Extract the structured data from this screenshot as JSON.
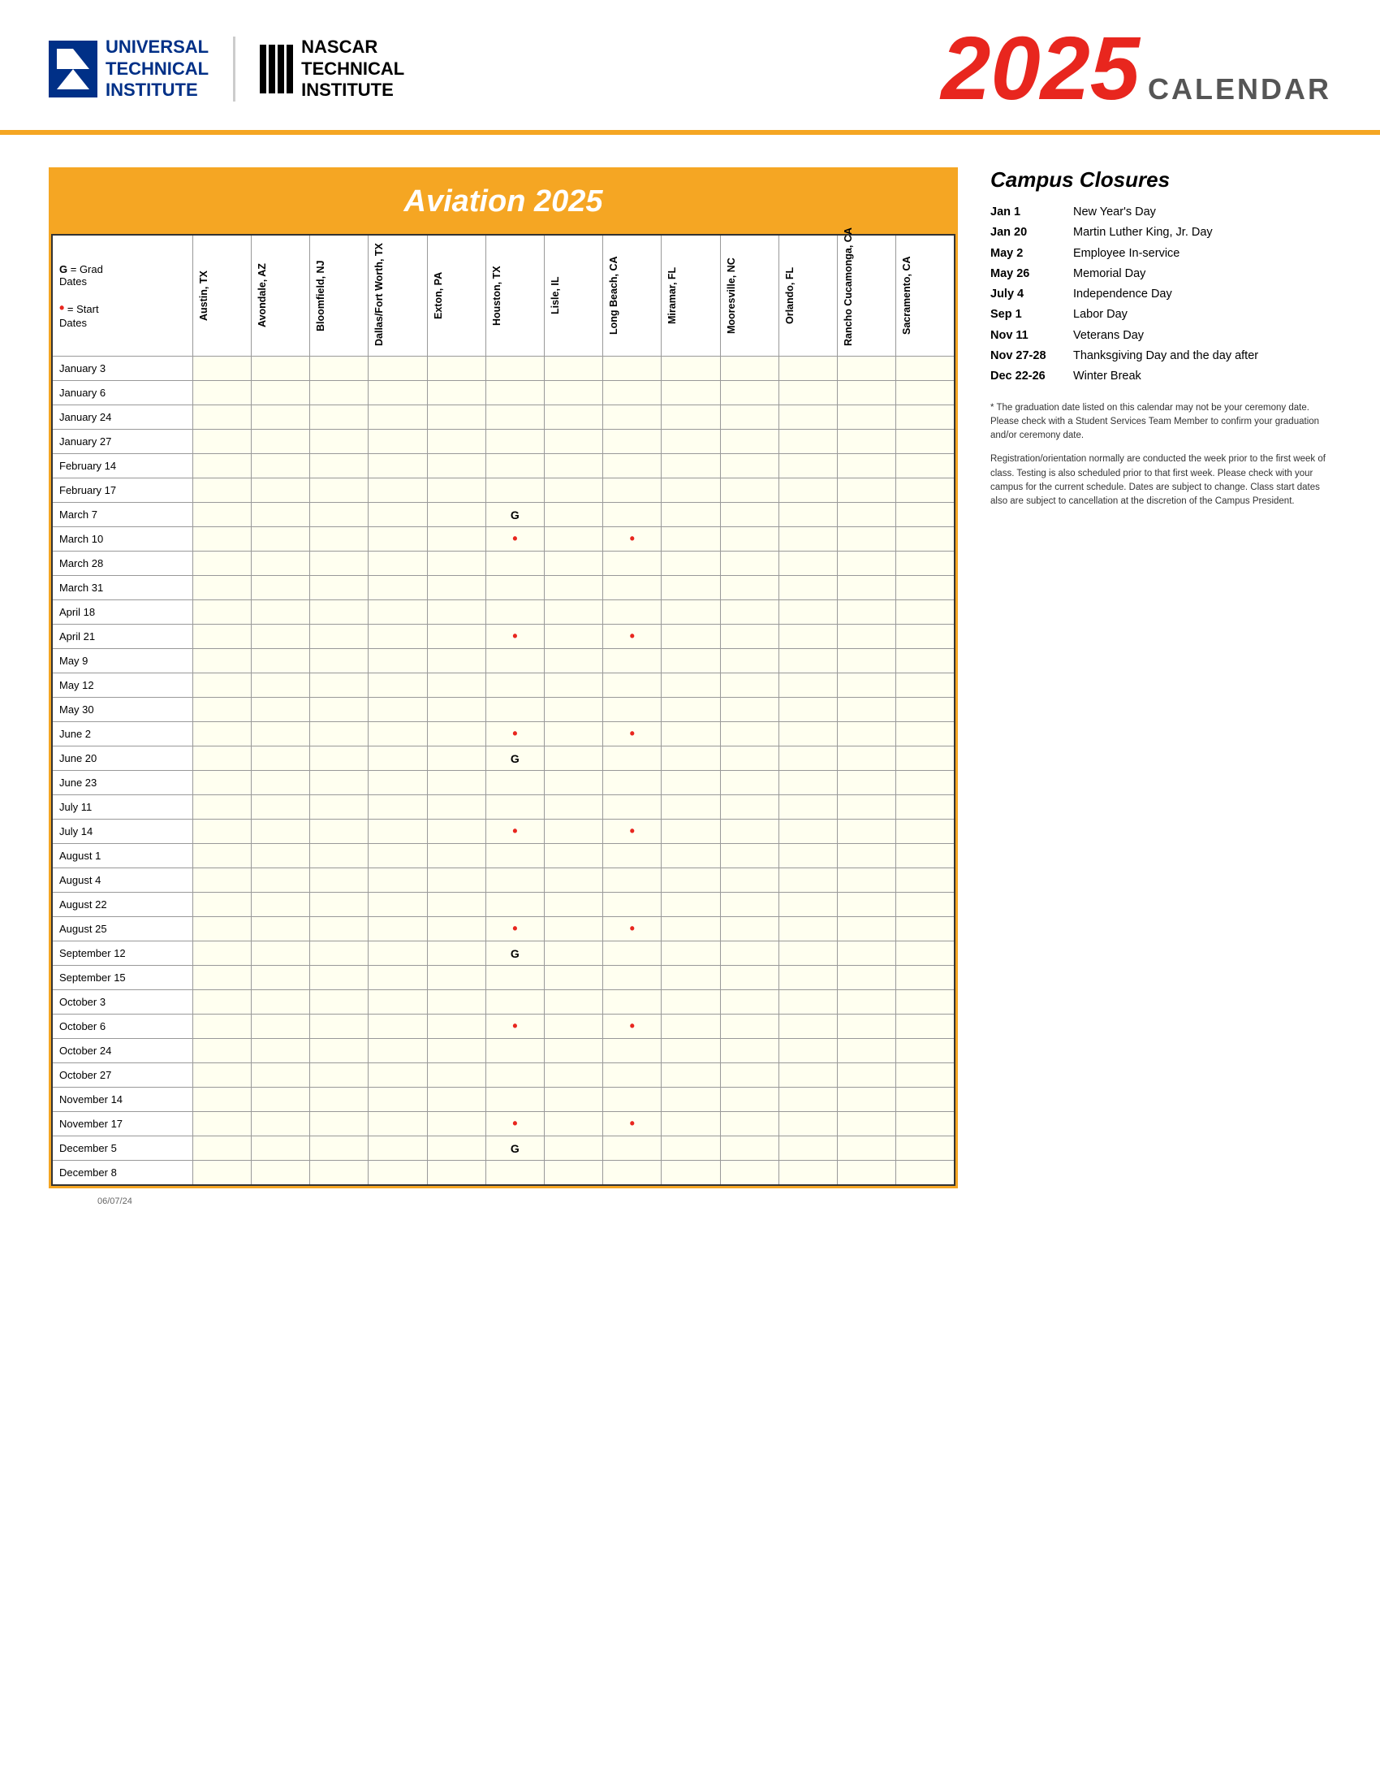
{
  "header": {
    "uti_line1": "UNIVERSAL",
    "uti_line2": "TECHNICAL",
    "uti_line3": "INSTITUTE",
    "nascar_line1": "NASCAR",
    "nascar_line2": "TECHNICAL",
    "nascar_line3": "INSTITUTE",
    "year": "2025",
    "calendar_label": "CALENDAR"
  },
  "calendar": {
    "title": "Aviation 2025",
    "legend_grad": "G = Grad Dates",
    "legend_start": "• = Start Dates",
    "columns": [
      "Austin, TX",
      "Avondale, AZ",
      "Bloomfield, NJ",
      "Dallas/Fort Worth, TX",
      "Exton, PA",
      "Houston, TX",
      "Lisle, IL",
      "Long Beach, CA",
      "Miramar, FL",
      "Mooresville, NC",
      "Orlando, FL",
      "Rancho Cucamonga, CA",
      "Sacramento, CA"
    ],
    "rows": [
      {
        "date": "January 3",
        "cells": [
          "",
          "",
          "",
          "",
          "",
          "",
          "",
          "",
          "",
          "",
          "",
          "",
          ""
        ]
      },
      {
        "date": "January 6",
        "cells": [
          "",
          "",
          "",
          "",
          "",
          "",
          "",
          "",
          "",
          "",
          "",
          "",
          ""
        ]
      },
      {
        "date": "January 24",
        "cells": [
          "",
          "",
          "",
          "",
          "",
          "",
          "",
          "",
          "",
          "",
          "",
          "",
          ""
        ]
      },
      {
        "date": "January 27",
        "cells": [
          "",
          "",
          "",
          "",
          "",
          "",
          "",
          "",
          "",
          "",
          "",
          "",
          ""
        ]
      },
      {
        "date": "February 14",
        "cells": [
          "",
          "",
          "",
          "",
          "",
          "",
          "",
          "",
          "",
          "",
          "",
          "",
          ""
        ]
      },
      {
        "date": "February 17",
        "cells": [
          "",
          "",
          "",
          "",
          "",
          "",
          "",
          "",
          "",
          "",
          "",
          "",
          ""
        ]
      },
      {
        "date": "March 7",
        "cells": [
          "",
          "",
          "",
          "",
          "",
          "G",
          "",
          "",
          "",
          "",
          "",
          "",
          ""
        ]
      },
      {
        "date": "March 10",
        "cells": [
          "",
          "",
          "",
          "",
          "",
          "•",
          "",
          "•",
          "",
          "",
          "",
          "",
          ""
        ]
      },
      {
        "date": "March 28",
        "cells": [
          "",
          "",
          "",
          "",
          "",
          "",
          "",
          "",
          "",
          "",
          "",
          "",
          ""
        ]
      },
      {
        "date": "March 31",
        "cells": [
          "",
          "",
          "",
          "",
          "",
          "",
          "",
          "",
          "",
          "",
          "",
          "",
          ""
        ]
      },
      {
        "date": "April 18",
        "cells": [
          "",
          "",
          "",
          "",
          "",
          "",
          "",
          "",
          "",
          "",
          "",
          "",
          ""
        ]
      },
      {
        "date": "April 21",
        "cells": [
          "",
          "",
          "",
          "",
          "",
          "•",
          "",
          "•",
          "",
          "",
          "",
          "",
          ""
        ]
      },
      {
        "date": "May 9",
        "cells": [
          "",
          "",
          "",
          "",
          "",
          "",
          "",
          "",
          "",
          "",
          "",
          "",
          ""
        ]
      },
      {
        "date": "May 12",
        "cells": [
          "",
          "",
          "",
          "",
          "",
          "",
          "",
          "",
          "",
          "",
          "",
          "",
          ""
        ]
      },
      {
        "date": "May 30",
        "cells": [
          "",
          "",
          "",
          "",
          "",
          "",
          "",
          "",
          "",
          "",
          "",
          "",
          ""
        ]
      },
      {
        "date": "June 2",
        "cells": [
          "",
          "",
          "",
          "",
          "",
          "•",
          "",
          "•",
          "",
          "",
          "",
          "",
          ""
        ]
      },
      {
        "date": "June 20",
        "cells": [
          "",
          "",
          "",
          "",
          "",
          "G",
          "",
          "",
          "",
          "",
          "",
          "",
          ""
        ]
      },
      {
        "date": "June 23",
        "cells": [
          "",
          "",
          "",
          "",
          "",
          "",
          "",
          "",
          "",
          "",
          "",
          "",
          ""
        ]
      },
      {
        "date": "July 11",
        "cells": [
          "",
          "",
          "",
          "",
          "",
          "",
          "",
          "",
          "",
          "",
          "",
          "",
          ""
        ]
      },
      {
        "date": "July 14",
        "cells": [
          "",
          "",
          "",
          "",
          "",
          "•",
          "",
          "•",
          "",
          "",
          "",
          "",
          ""
        ]
      },
      {
        "date": "August 1",
        "cells": [
          "",
          "",
          "",
          "",
          "",
          "",
          "",
          "",
          "",
          "",
          "",
          "",
          ""
        ]
      },
      {
        "date": "August 4",
        "cells": [
          "",
          "",
          "",
          "",
          "",
          "",
          "",
          "",
          "",
          "",
          "",
          "",
          ""
        ]
      },
      {
        "date": "August 22",
        "cells": [
          "",
          "",
          "",
          "",
          "",
          "",
          "",
          "",
          "",
          "",
          "",
          "",
          ""
        ]
      },
      {
        "date": "August 25",
        "cells": [
          "",
          "",
          "",
          "",
          "",
          "•",
          "",
          "•",
          "",
          "",
          "",
          "",
          ""
        ]
      },
      {
        "date": "September 12",
        "cells": [
          "",
          "",
          "",
          "",
          "",
          "G",
          "",
          "",
          "",
          "",
          "",
          "",
          ""
        ]
      },
      {
        "date": "September 15",
        "cells": [
          "",
          "",
          "",
          "",
          "",
          "",
          "",
          "",
          "",
          "",
          "",
          "",
          ""
        ]
      },
      {
        "date": "October 3",
        "cells": [
          "",
          "",
          "",
          "",
          "",
          "",
          "",
          "",
          "",
          "",
          "",
          "",
          ""
        ]
      },
      {
        "date": "October 6",
        "cells": [
          "",
          "",
          "",
          "",
          "",
          "•",
          "",
          "•",
          "",
          "",
          "",
          "",
          ""
        ]
      },
      {
        "date": "October 24",
        "cells": [
          "",
          "",
          "",
          "",
          "",
          "",
          "",
          "",
          "",
          "",
          "",
          "",
          ""
        ]
      },
      {
        "date": "October 27",
        "cells": [
          "",
          "",
          "",
          "",
          "",
          "",
          "",
          "",
          "",
          "",
          "",
          "",
          ""
        ]
      },
      {
        "date": "November 14",
        "cells": [
          "",
          "",
          "",
          "",
          "",
          "",
          "",
          "",
          "",
          "",
          "",
          "",
          ""
        ]
      },
      {
        "date": "November 17",
        "cells": [
          "",
          "",
          "",
          "",
          "",
          "•",
          "",
          "•",
          "",
          "",
          "",
          "",
          ""
        ]
      },
      {
        "date": "December 5",
        "cells": [
          "",
          "",
          "",
          "",
          "",
          "G",
          "",
          "",
          "",
          "",
          "",
          "",
          ""
        ]
      },
      {
        "date": "December 8",
        "cells": [
          "",
          "",
          "",
          "",
          "",
          "",
          "",
          "",
          "",
          "",
          "",
          "",
          ""
        ]
      }
    ]
  },
  "campus_closures": {
    "title": "Campus Closures",
    "items": [
      {
        "date": "Jan 1",
        "desc": "New Year's Day"
      },
      {
        "date": "Jan 20",
        "desc": "Martin Luther King, Jr. Day"
      },
      {
        "date": "May 2",
        "desc": "Employee In-service"
      },
      {
        "date": "May 26",
        "desc": "Memorial Day"
      },
      {
        "date": "July 4",
        "desc": "Independence Day"
      },
      {
        "date": "Sep 1",
        "desc": "Labor Day"
      },
      {
        "date": "Nov 11",
        "desc": "Veterans Day"
      },
      {
        "date": "Nov 27-28",
        "desc": "Thanksgiving Day and the day after"
      },
      {
        "date": "Dec 22-26",
        "desc": "Winter Break"
      }
    ],
    "footnote1": "* The graduation date listed on this calendar may not be your ceremony date. Please check with a Student Services Team Member to confirm your graduation and/or ceremony date.",
    "footnote2": "Registration/orientation normally are conducted the week prior to the first week of class. Testing is also scheduled prior to that first week. Please check with your campus for the current schedule. Dates are subject to change. Class start dates also are subject to cancellation at the discretion of the Campus President."
  },
  "footer": {
    "date_code": "06/07/24"
  }
}
